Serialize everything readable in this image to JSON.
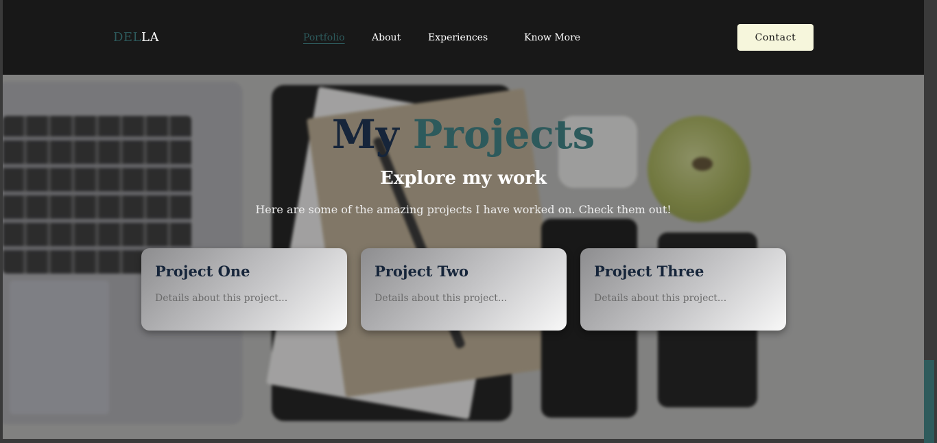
{
  "logo": {
    "part1": "DEL",
    "part2": "LA"
  },
  "nav": {
    "items": [
      {
        "label": "Portfolio",
        "active": true
      },
      {
        "label": "About"
      },
      {
        "label": "Experiences"
      },
      {
        "label": "Know More"
      }
    ],
    "contact_label": "Contact"
  },
  "hero": {
    "title_word1": "My",
    "title_word2": "Projects",
    "subtitle": "Explore my work",
    "description": "Here are some of the amazing projects I have worked on. Check them out!"
  },
  "projects": [
    {
      "title": "Project One",
      "description": "Details about this project..."
    },
    {
      "title": "Project Two",
      "description": "Details about this project..."
    },
    {
      "title": "Project Three",
      "description": "Details about this project..."
    }
  ],
  "colors": {
    "accent_teal": "#2d5a5c",
    "dark_navy": "#16253a",
    "navbar_bg": "#181818",
    "contact_bg": "#f6f6dc"
  }
}
